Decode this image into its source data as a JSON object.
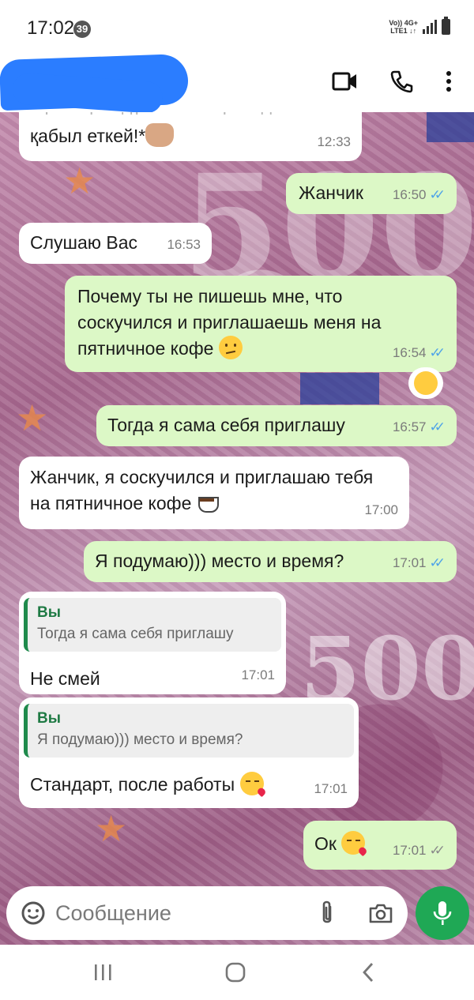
{
  "status_bar": {
    "time": "17:02",
    "notification_count": "39",
    "network_top": "Vo)) 4G+",
    "network_bottom": "LTE1 ↓↑"
  },
  "header": {
    "contact_name": "",
    "video_call_icon": "video-camera-icon",
    "voice_call_icon": "phone-icon",
    "menu_icon": "more-vert-icon"
  },
  "messages": [
    {
      "direction": "in",
      "text": "жұма күнгі дүға тілектерімізді қабыл еткей!*",
      "emoji": "raised-hands",
      "time": "12:33"
    },
    {
      "direction": "out",
      "text": "Жанчик",
      "time": "16:50",
      "status": "read"
    },
    {
      "direction": "in",
      "text": "Слушаю Вас",
      "time": "16:53"
    },
    {
      "direction": "out",
      "text": "Почему ты не пишешь мне, что соскучился и приглашаешь меня на пятничное кофе",
      "emoji": "confused-face",
      "time": "16:54",
      "status": "read",
      "reaction": "smiling-face"
    },
    {
      "direction": "out",
      "text": "Тогда я сама себя приглашу",
      "time": "16:57",
      "status": "read"
    },
    {
      "direction": "in",
      "text": "Жанчик, я соскучился и приглашаю тебя на пятничное кофе",
      "emoji": "hot-beverage",
      "time": "17:00"
    },
    {
      "direction": "out",
      "text": "Я подумаю))) место и время?",
      "time": "17:01",
      "status": "read"
    },
    {
      "direction": "in",
      "quote_author": "Вы",
      "quote_text": "Тогда я сама себя приглашу",
      "text": "Не смей",
      "time": "17:01"
    },
    {
      "direction": "in",
      "quote_author": "Вы",
      "quote_text": "Я подумаю))) место и время?",
      "text": "Стандарт, после работы",
      "emoji": "face-blowing-kiss",
      "time": "17:01"
    },
    {
      "direction": "out",
      "text": "Ок",
      "emoji": "face-blowing-kiss",
      "time": "17:01",
      "status": "delivered"
    }
  ],
  "composer": {
    "placeholder": "Сообщение",
    "emoji_icon": "sticker-smile-icon",
    "attach_icon": "paperclip-icon",
    "camera_icon": "camera-icon",
    "mic_icon": "microphone-icon"
  },
  "colors": {
    "incoming_bubble": "#ffffff",
    "outgoing_bubble": "#dcf8c6",
    "read_ticks": "#4fa3e8",
    "mic_button": "#1fa855",
    "quote_accent": "#1f8a4c"
  },
  "navbar": {
    "recent_icon": "recent-apps-icon",
    "home_icon": "home-icon",
    "back_icon": "back-icon"
  }
}
